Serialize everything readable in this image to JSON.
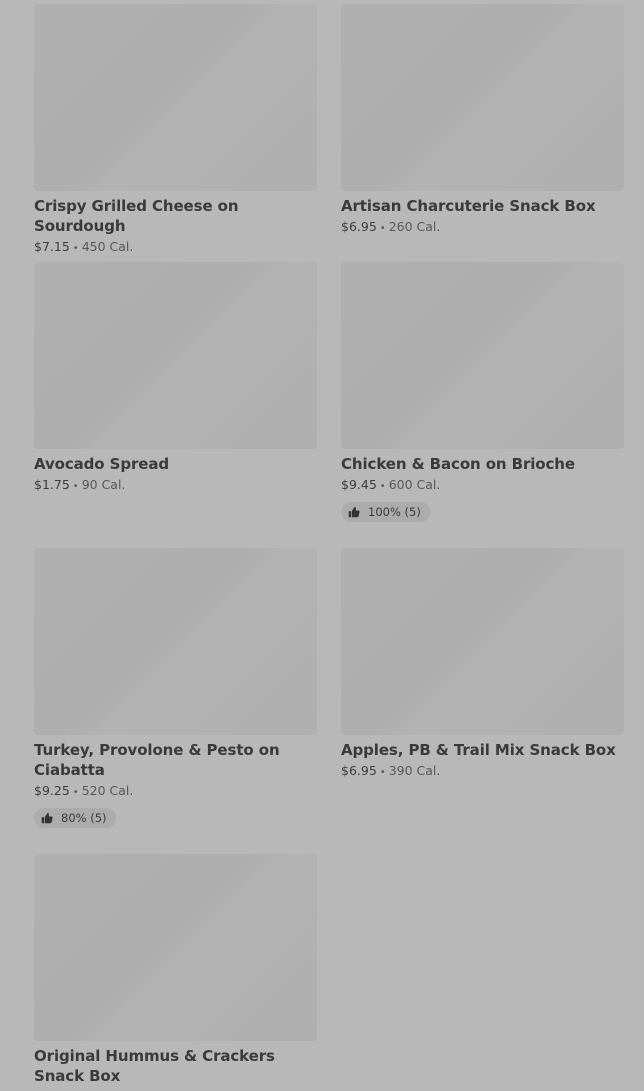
{
  "menu_items": [
    {
      "name": "Crispy Grilled Cheese on Sourdough",
      "price": "$7.15",
      "separator": "•",
      "calories": "450 Cal.",
      "rating": null
    },
    {
      "name": "Artisan Charcuterie Snack Box",
      "price": "$6.95",
      "separator": "•",
      "calories": "260 Cal.",
      "rating": null
    },
    {
      "name": "Avocado Spread",
      "price": "$1.75",
      "separator": "•",
      "calories": "90 Cal.",
      "rating": null
    },
    {
      "name": "Chicken & Bacon on Brioche",
      "price": "$9.45",
      "separator": "•",
      "calories": "600 Cal.",
      "rating": "100% (5)"
    },
    {
      "name": "Turkey, Provolone & Pesto on Ciabatta",
      "price": "$9.25",
      "separator": "•",
      "calories": "520 Cal.",
      "rating": "80% (5)"
    },
    {
      "name": "Apples, PB & Trail Mix Snack Box",
      "price": "$6.95",
      "separator": "•",
      "calories": "390 Cal.",
      "rating": null
    },
    {
      "name": "Original Hummus & Crackers Snack Box",
      "price": "",
      "separator": "",
      "calories": "",
      "rating": null
    }
  ],
  "icons": {
    "rating": "thumbs-up-icon"
  },
  "colors": {
    "overlay": "#b8b8b8",
    "image_placeholder": "#b0b0b0",
    "text": "#3a3a3a"
  }
}
